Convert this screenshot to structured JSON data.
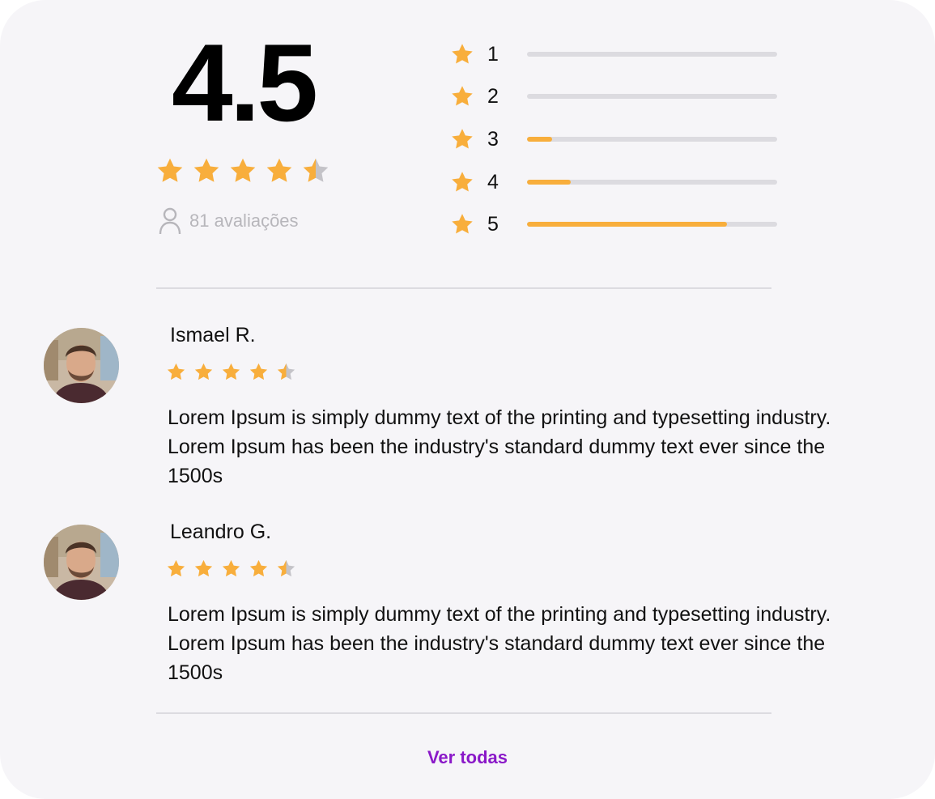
{
  "summary": {
    "score": "4.5",
    "rating_value": 4.5,
    "rating_max": 5,
    "review_count_text": "81 avaliações",
    "user_icon": "user-icon"
  },
  "distribution": [
    {
      "label": "1",
      "fraction": 0.0
    },
    {
      "label": "2",
      "fraction": 0.0
    },
    {
      "label": "3",
      "fraction": 0.1
    },
    {
      "label": "4",
      "fraction": 0.175
    },
    {
      "label": "5",
      "fraction": 0.8
    }
  ],
  "reviews": [
    {
      "name": "Ismael R.",
      "rating": 4.5,
      "text": "Lorem Ipsum is simply dummy text of the printing and typesetting industry. Lorem Ipsum has been the industry's standard dummy text ever since the 1500s"
    },
    {
      "name": "Leandro G.",
      "rating": 4.5,
      "text": "Lorem Ipsum is simply dummy text of the printing and typesetting industry. Lorem Ipsum has been the industry's standard dummy text ever since the 1500s"
    }
  ],
  "footer": {
    "see_all_label": "Ver todas"
  },
  "colors": {
    "star_filled": "#f8ae3c",
    "star_empty": "#c4c3c8",
    "bar_track": "#dcdbe0",
    "link": "#8a18c8",
    "card_background": "#f6f5f8"
  }
}
